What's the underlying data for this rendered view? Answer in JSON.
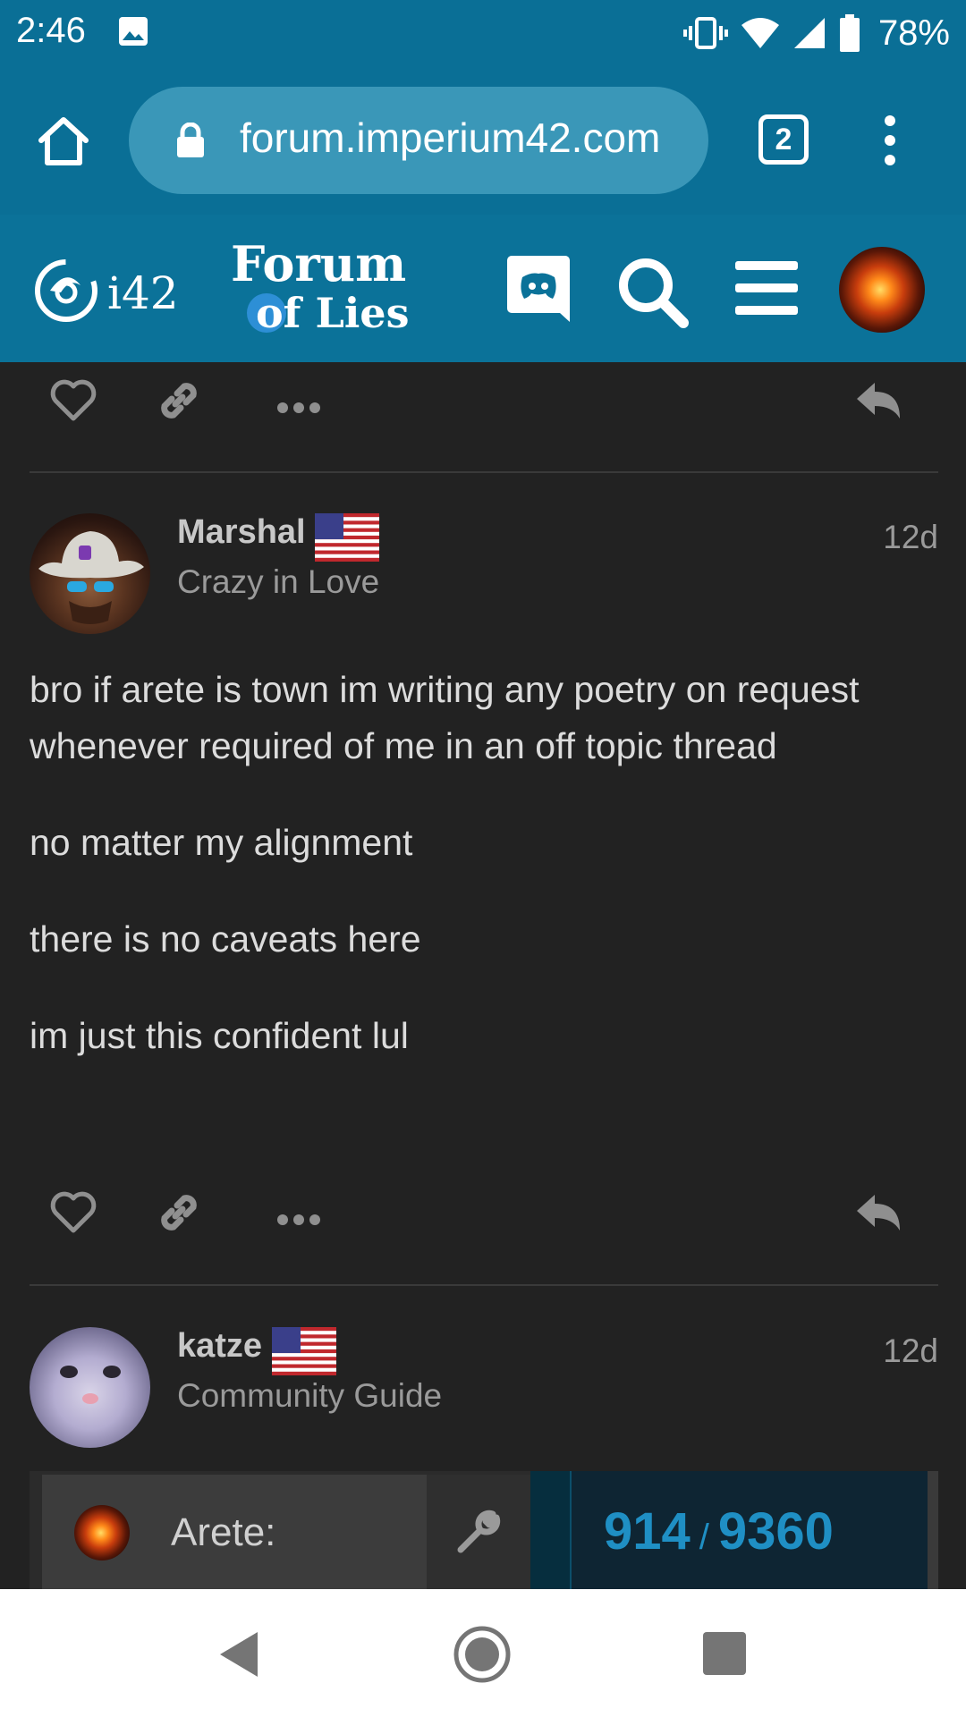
{
  "status_bar": {
    "time": "2:46",
    "battery": "78%"
  },
  "browser": {
    "url": "forum.imperium42.com",
    "tab_count": "2"
  },
  "header": {
    "site_short": "i42",
    "forum_logo_line1": "Forum",
    "forum_logo_line2": "of Lies"
  },
  "posts": [
    {
      "username": "Marshal",
      "user_title": "Crazy in Love",
      "date": "12d",
      "body": [
        "bro if arete is town im writing any poetry on request whenever required of me in an off topic thread",
        "no matter my alignment",
        "there is no caveats here",
        "im just this confident lul"
      ]
    },
    {
      "username": "katze",
      "user_title": "Community Guide",
      "date": "12d",
      "body": []
    }
  ],
  "composer": {
    "reply_user": "Arete:",
    "progress_current": "914",
    "progress_separator": "/",
    "progress_total": "9360"
  },
  "colors": {
    "header_blue": "#0a6f96",
    "background": "#222222",
    "progress_blue": "#1f8fc4"
  },
  "icons": [
    "home-icon",
    "lock-icon",
    "tabs-icon",
    "overflow-menu-icon",
    "discord-icon",
    "search-icon",
    "hamburger-menu-icon",
    "heart-icon",
    "link-icon",
    "more-icon",
    "reply-icon",
    "wrench-icon",
    "flag-us-icon",
    "nav-back-icon",
    "nav-home-icon",
    "nav-recent-icon"
  ]
}
